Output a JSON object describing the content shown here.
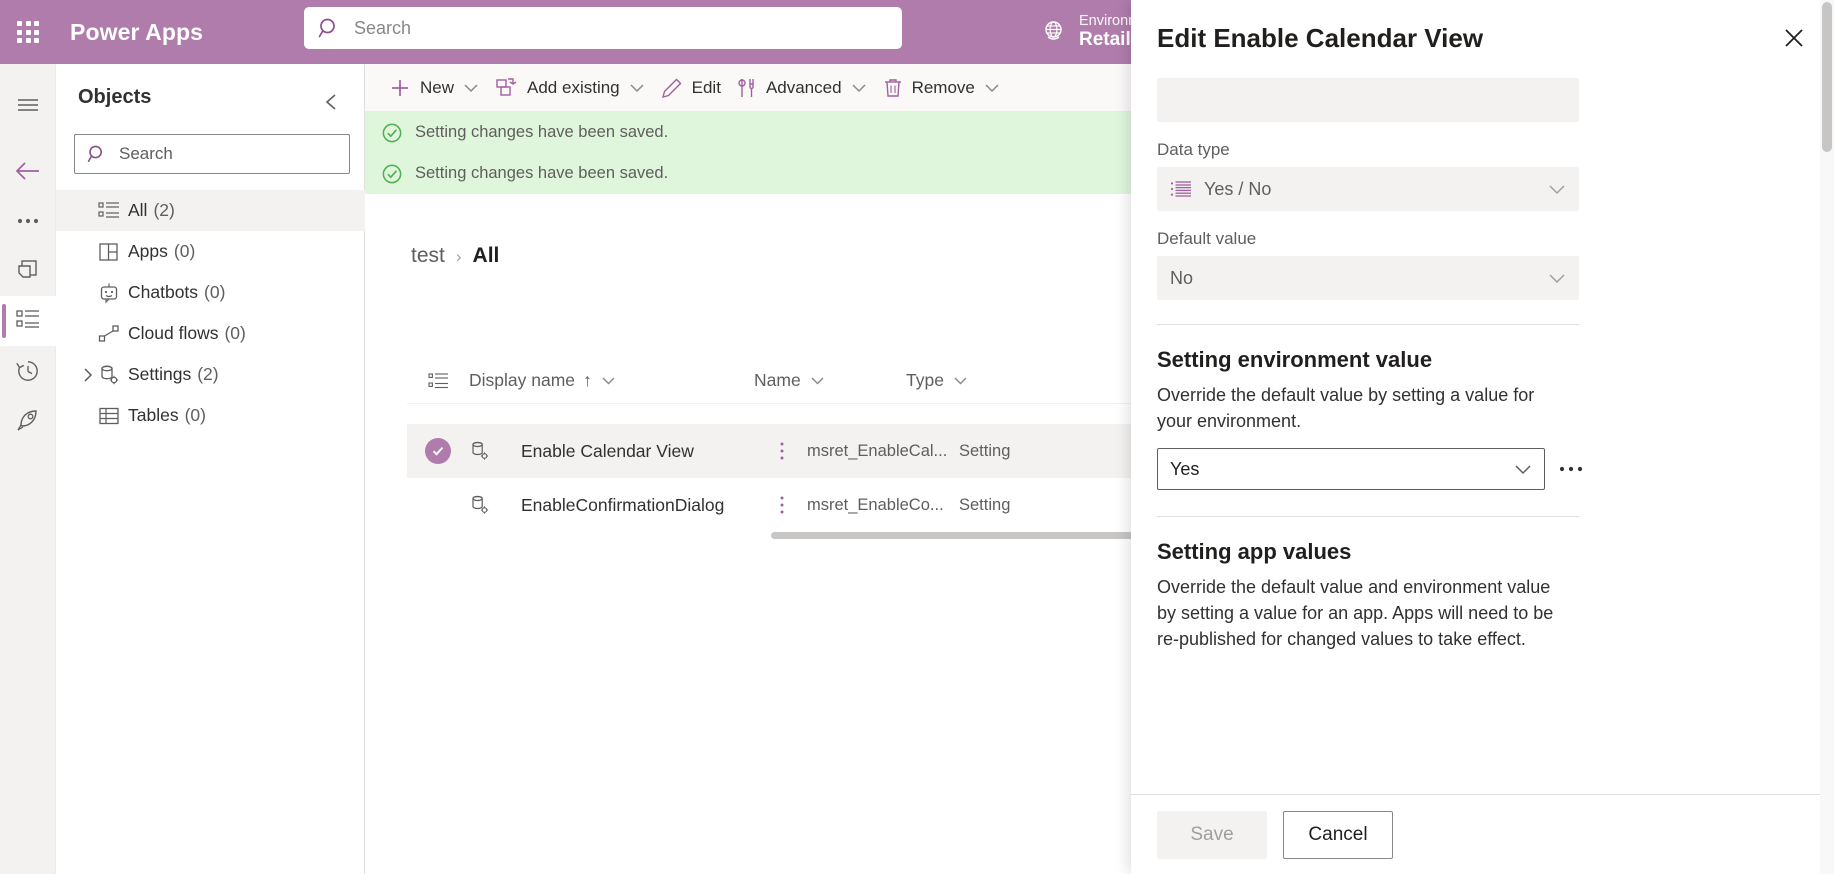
{
  "header": {
    "waffle_icon": "app-launcher-icon",
    "brand": "Power Apps",
    "search_placeholder": "Search",
    "search_value": "",
    "search_icon": "search-icon",
    "environment_label": "Environment",
    "environment_name": "RetailS",
    "globe_icon": "globe-icon",
    "bar_color": "#b07cac"
  },
  "rail": {
    "items": [
      {
        "name": "hamburger-icon",
        "label": "Menu"
      },
      {
        "name": "back-arrow-icon",
        "label": "Back"
      },
      {
        "name": "ellipsis-icon",
        "label": "More"
      },
      {
        "name": "solutions-icon",
        "label": "Solutions"
      },
      {
        "name": "objects-list-icon",
        "label": "Objects"
      },
      {
        "name": "history-icon",
        "label": "History"
      },
      {
        "name": "publish-rocket-icon",
        "label": "Publish"
      }
    ],
    "selected_index": 4
  },
  "objects": {
    "title": "Objects",
    "collapse_icon": "chevron-left-icon",
    "search_placeholder": "Search",
    "search_value": "",
    "tree": [
      {
        "label": "All",
        "count": "(2)",
        "icon": "list-icon",
        "expandable": false,
        "active": true
      },
      {
        "label": "Apps",
        "count": "(0)",
        "icon": "apps-grid-icon",
        "expandable": false,
        "active": false
      },
      {
        "label": "Chatbots",
        "count": "(0)",
        "icon": "chatbot-icon",
        "expandable": false,
        "active": false
      },
      {
        "label": "Cloud flows",
        "count": "(0)",
        "icon": "cloud-flow-icon",
        "expandable": false,
        "active": false
      },
      {
        "label": "Settings",
        "count": "(2)",
        "icon": "settings-db-icon",
        "expandable": true,
        "active": false
      },
      {
        "label": "Tables",
        "count": "(0)",
        "icon": "table-icon",
        "expandable": false,
        "active": false
      }
    ]
  },
  "toolbar": {
    "commands": [
      {
        "label": "New",
        "icon": "plus-icon",
        "caret": true
      },
      {
        "label": "Add existing",
        "icon": "add-existing-icon",
        "caret": true
      },
      {
        "label": "Edit",
        "icon": "pencil-icon",
        "caret": false
      },
      {
        "label": "Advanced",
        "icon": "advanced-tools-icon",
        "caret": true
      },
      {
        "label": "Remove",
        "icon": "trash-icon",
        "caret": true
      }
    ]
  },
  "messages": [
    {
      "text": "Setting changes have been saved.",
      "icon": "success-check-icon"
    },
    {
      "text": "Setting changes have been saved.",
      "icon": "success-check-icon"
    }
  ],
  "breadcrumb": {
    "parent": "test",
    "separator": "›",
    "current": "All"
  },
  "grid": {
    "select_all_icon": "select-all-icon",
    "columns": [
      {
        "label": "Display name",
        "sort": "↑",
        "caret": true
      },
      {
        "label": "Name",
        "sort": "",
        "caret": true
      },
      {
        "label": "Type",
        "sort": "",
        "caret": true
      }
    ],
    "rows": [
      {
        "selected": true,
        "icon": "setting-record-icon",
        "kebab_icon": "kebab-menu-icon",
        "display_name": "Enable Calendar View",
        "name": "msret_EnableCal...",
        "type": "Setting"
      },
      {
        "selected": false,
        "icon": "setting-record-icon",
        "kebab_icon": "kebab-menu-icon",
        "display_name": "EnableConfirmationDialog",
        "name": "msret_EnableCo...",
        "type": "Setting"
      }
    ]
  },
  "panel": {
    "title": "Edit Enable Calendar View",
    "close_icon": "close-icon",
    "top_field_value": "",
    "data_type_label": "Data type",
    "data_type_value": "Yes / No",
    "data_type_icon": "list-lines-icon",
    "default_value_label": "Default value",
    "default_value": "No",
    "chevron_icon": "chevron-down-icon",
    "env_section_title": "Setting environment value",
    "env_section_desc": "Override the default value by setting a value for your environment.",
    "env_value": "Yes",
    "env_more_icon": "ellipsis-icon",
    "app_section_title": "Setting app values",
    "app_section_desc": "Override the default value and environment value by setting a value for an app. Apps will need to be re-published for changed values to take effect.",
    "save_label": "Save",
    "cancel_label": "Cancel"
  }
}
